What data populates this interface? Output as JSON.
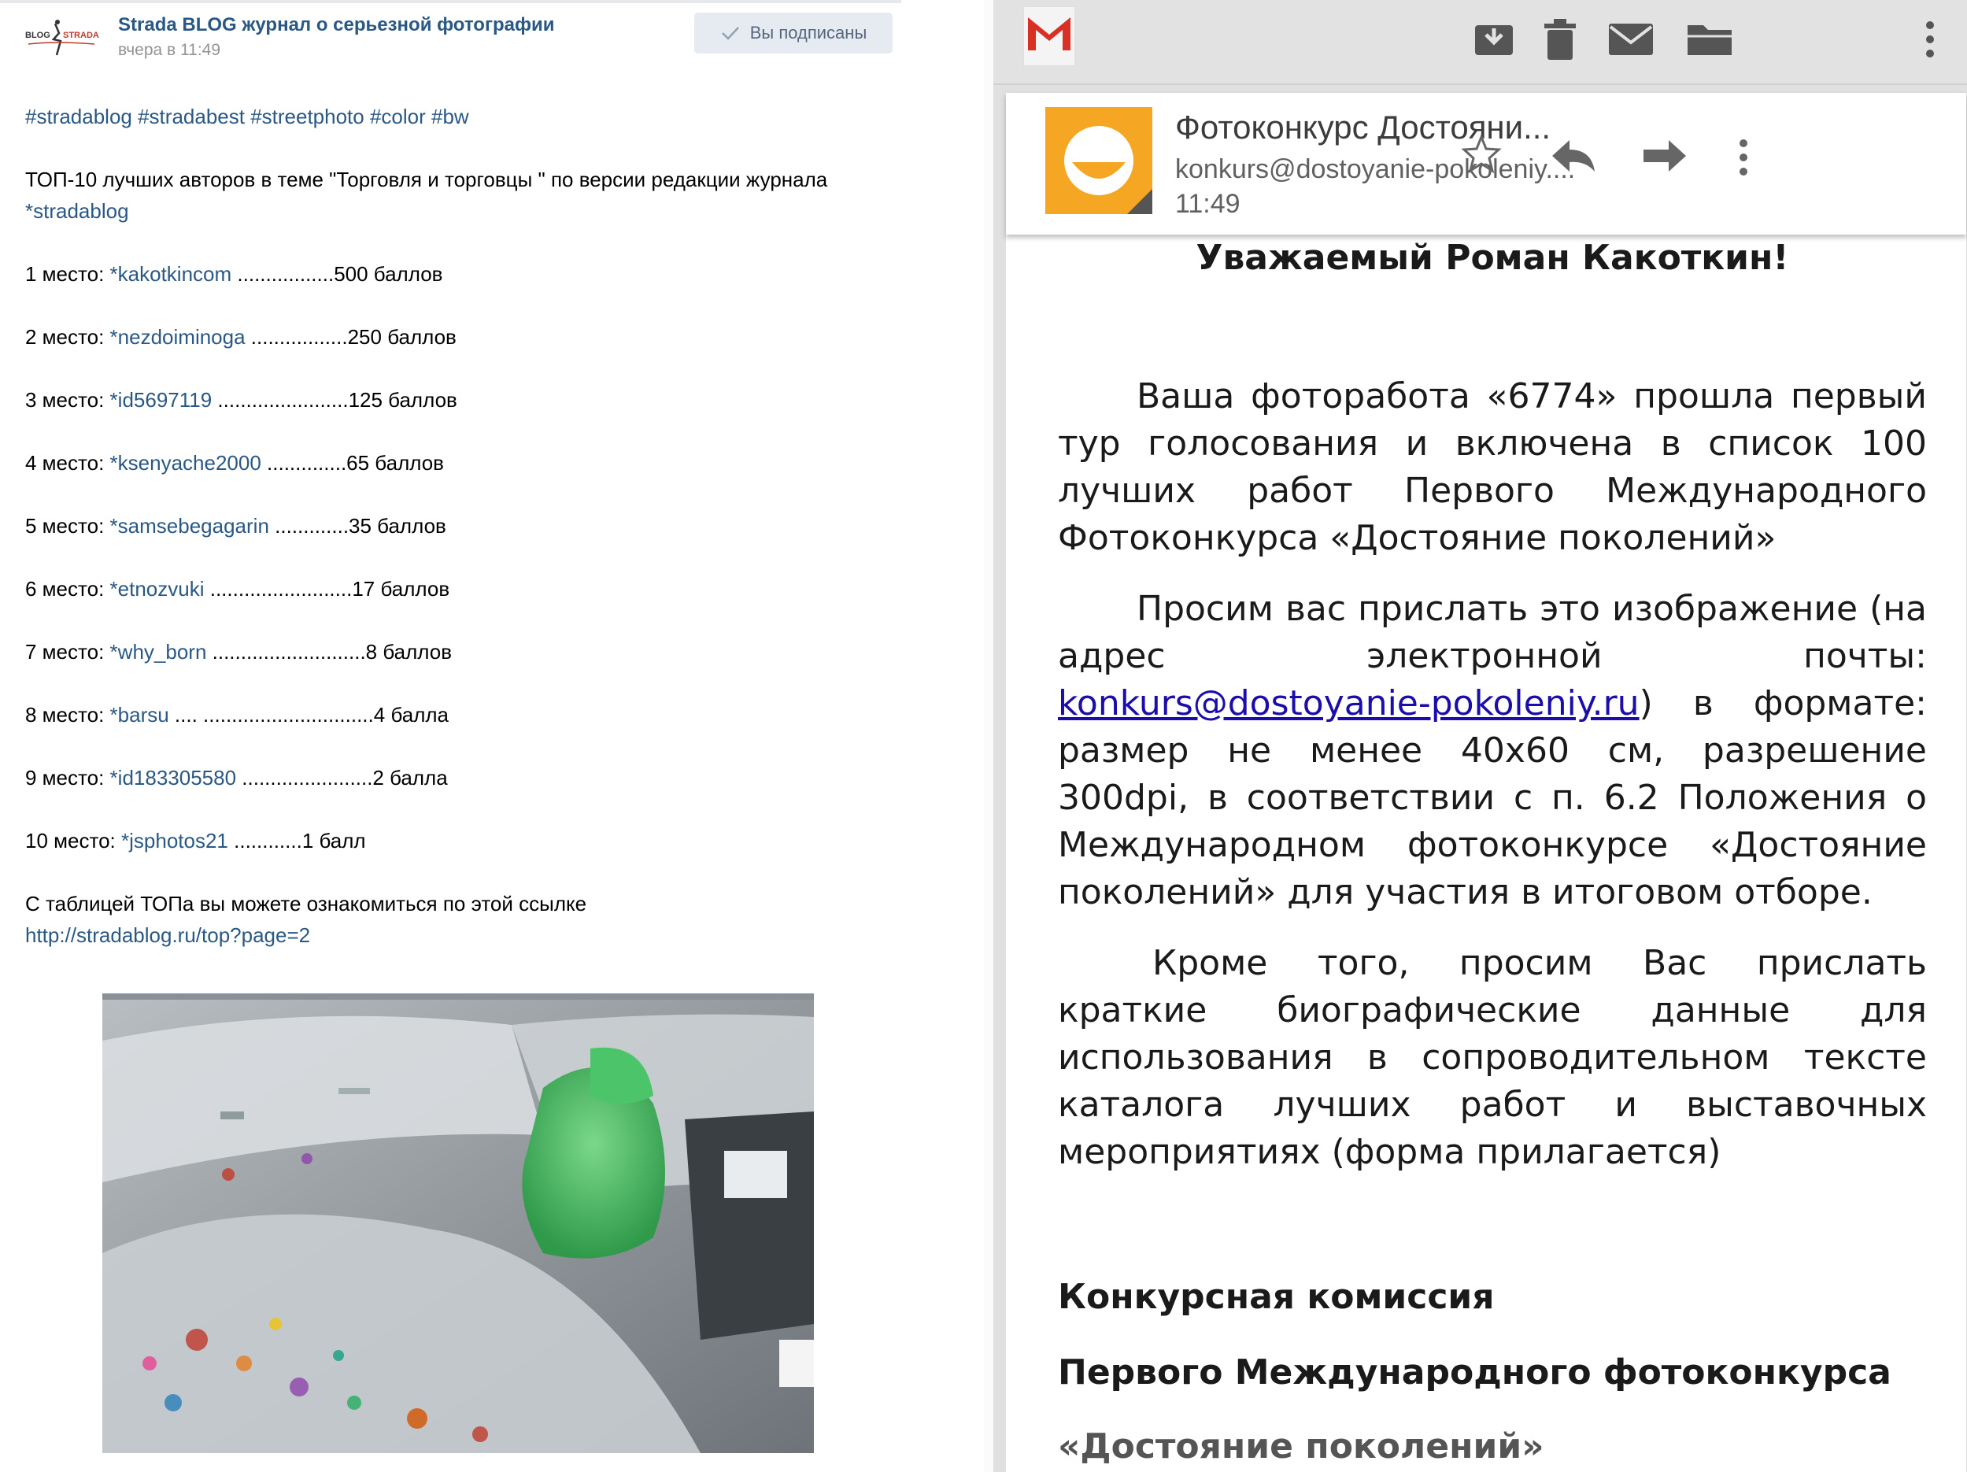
{
  "vk_post": {
    "author": "Strada BLOG журнал о серьезной фотографии",
    "date": "вчера в 11:49",
    "subscribe_label": "Вы подписаны",
    "hashtags": "#stradablog #stradabest #streetphoto #color #bw",
    "intro": "ТОП-10 лучших авторов в теме \"Торговля и торговцы \" по версии редакции журнала ",
    "intro_link": "*stradablog",
    "ranking": [
      {
        "place": "1 место: ",
        "user": "*kakotkincom",
        "score": " .................500 баллов"
      },
      {
        "place": "2 место: ",
        "user": "*nezdoiminoga",
        "score": " .................250 баллов"
      },
      {
        "place": "3 место: ",
        "user": "*id5697119",
        "score": " .......................125 баллов"
      },
      {
        "place": "4 место: ",
        "user": "*ksenyache2000",
        "score": " ..............65 баллов"
      },
      {
        "place": "5 место: ",
        "user": "*samsebegagarin",
        "score": " .............35 баллов"
      },
      {
        "place": "6 место: ",
        "user": "*etnozvuki",
        "score": " .........................17 баллов"
      },
      {
        "place": "7 место: ",
        "user": "*why_born",
        "score": " ...........................8 баллов"
      },
      {
        "place": "8 место: ",
        "user": "*barsu",
        "score": " .... ..............................4 балла"
      },
      {
        "place": "9 место: ",
        "user": "*id183305580",
        "score": " .......................2 балла"
      },
      {
        "place": "10 место: ",
        "user": "*jsphotos21",
        "score": " ............1 балл"
      }
    ],
    "outro": "С таблицей ТОПа вы можете ознакомиться по этой ссылке",
    "outro_link": "http://stradablog.ru/top?page=2"
  },
  "gmail": {
    "subject": "Фотоконкурс Достояни...",
    "from": "konkurs@dostoyanie-pokoleniy....",
    "time": "11:49",
    "greeting": "Уважаемый Роман Какоткин!",
    "para1": "Ваша фоторабота «6774» прошла первый тур голосования и включена в список 100 лучших работ Первого Международного Фотоконкурса «Достояние поколений»",
    "para2_before": "Просим вас прислать это изображение (на адрес электронной почты: ",
    "para2_link": "konkurs@dostoyanie-pokoleniy.ru",
    "para2_after": ") в формате: размер не менее 40х60 см, разрешение 300dpi, в соответствии с п. 6.2 Положения о Международном фотоконкурсе «Достояние поколений» для участия в итоговом отборе.",
    "para3": "Кроме того, просим Вас прислать краткие биографические данные для использования в сопроводительном тексте каталога лучших работ и выставочных мероприятиях (форма прилагается)",
    "sign1": "Конкурсная комиссия",
    "sign2": "Первого Международного фотоконкурса",
    "sign3": "«Достояние поколений»"
  },
  "colors": {
    "vk_link": "#2a5885",
    "vk_button_bg": "#e5ebf1",
    "gmail_red": "#d93025",
    "avatar_orange": "#f5a623",
    "mail_link": "#1a0dab"
  },
  "icons": {
    "toolbar": [
      "archive-icon",
      "delete-icon",
      "mark-unread-icon",
      "move-to-folder-icon",
      "overflow-menu-icon"
    ],
    "header": [
      "star-icon",
      "reply-icon",
      "forward-icon",
      "more-icon"
    ]
  }
}
